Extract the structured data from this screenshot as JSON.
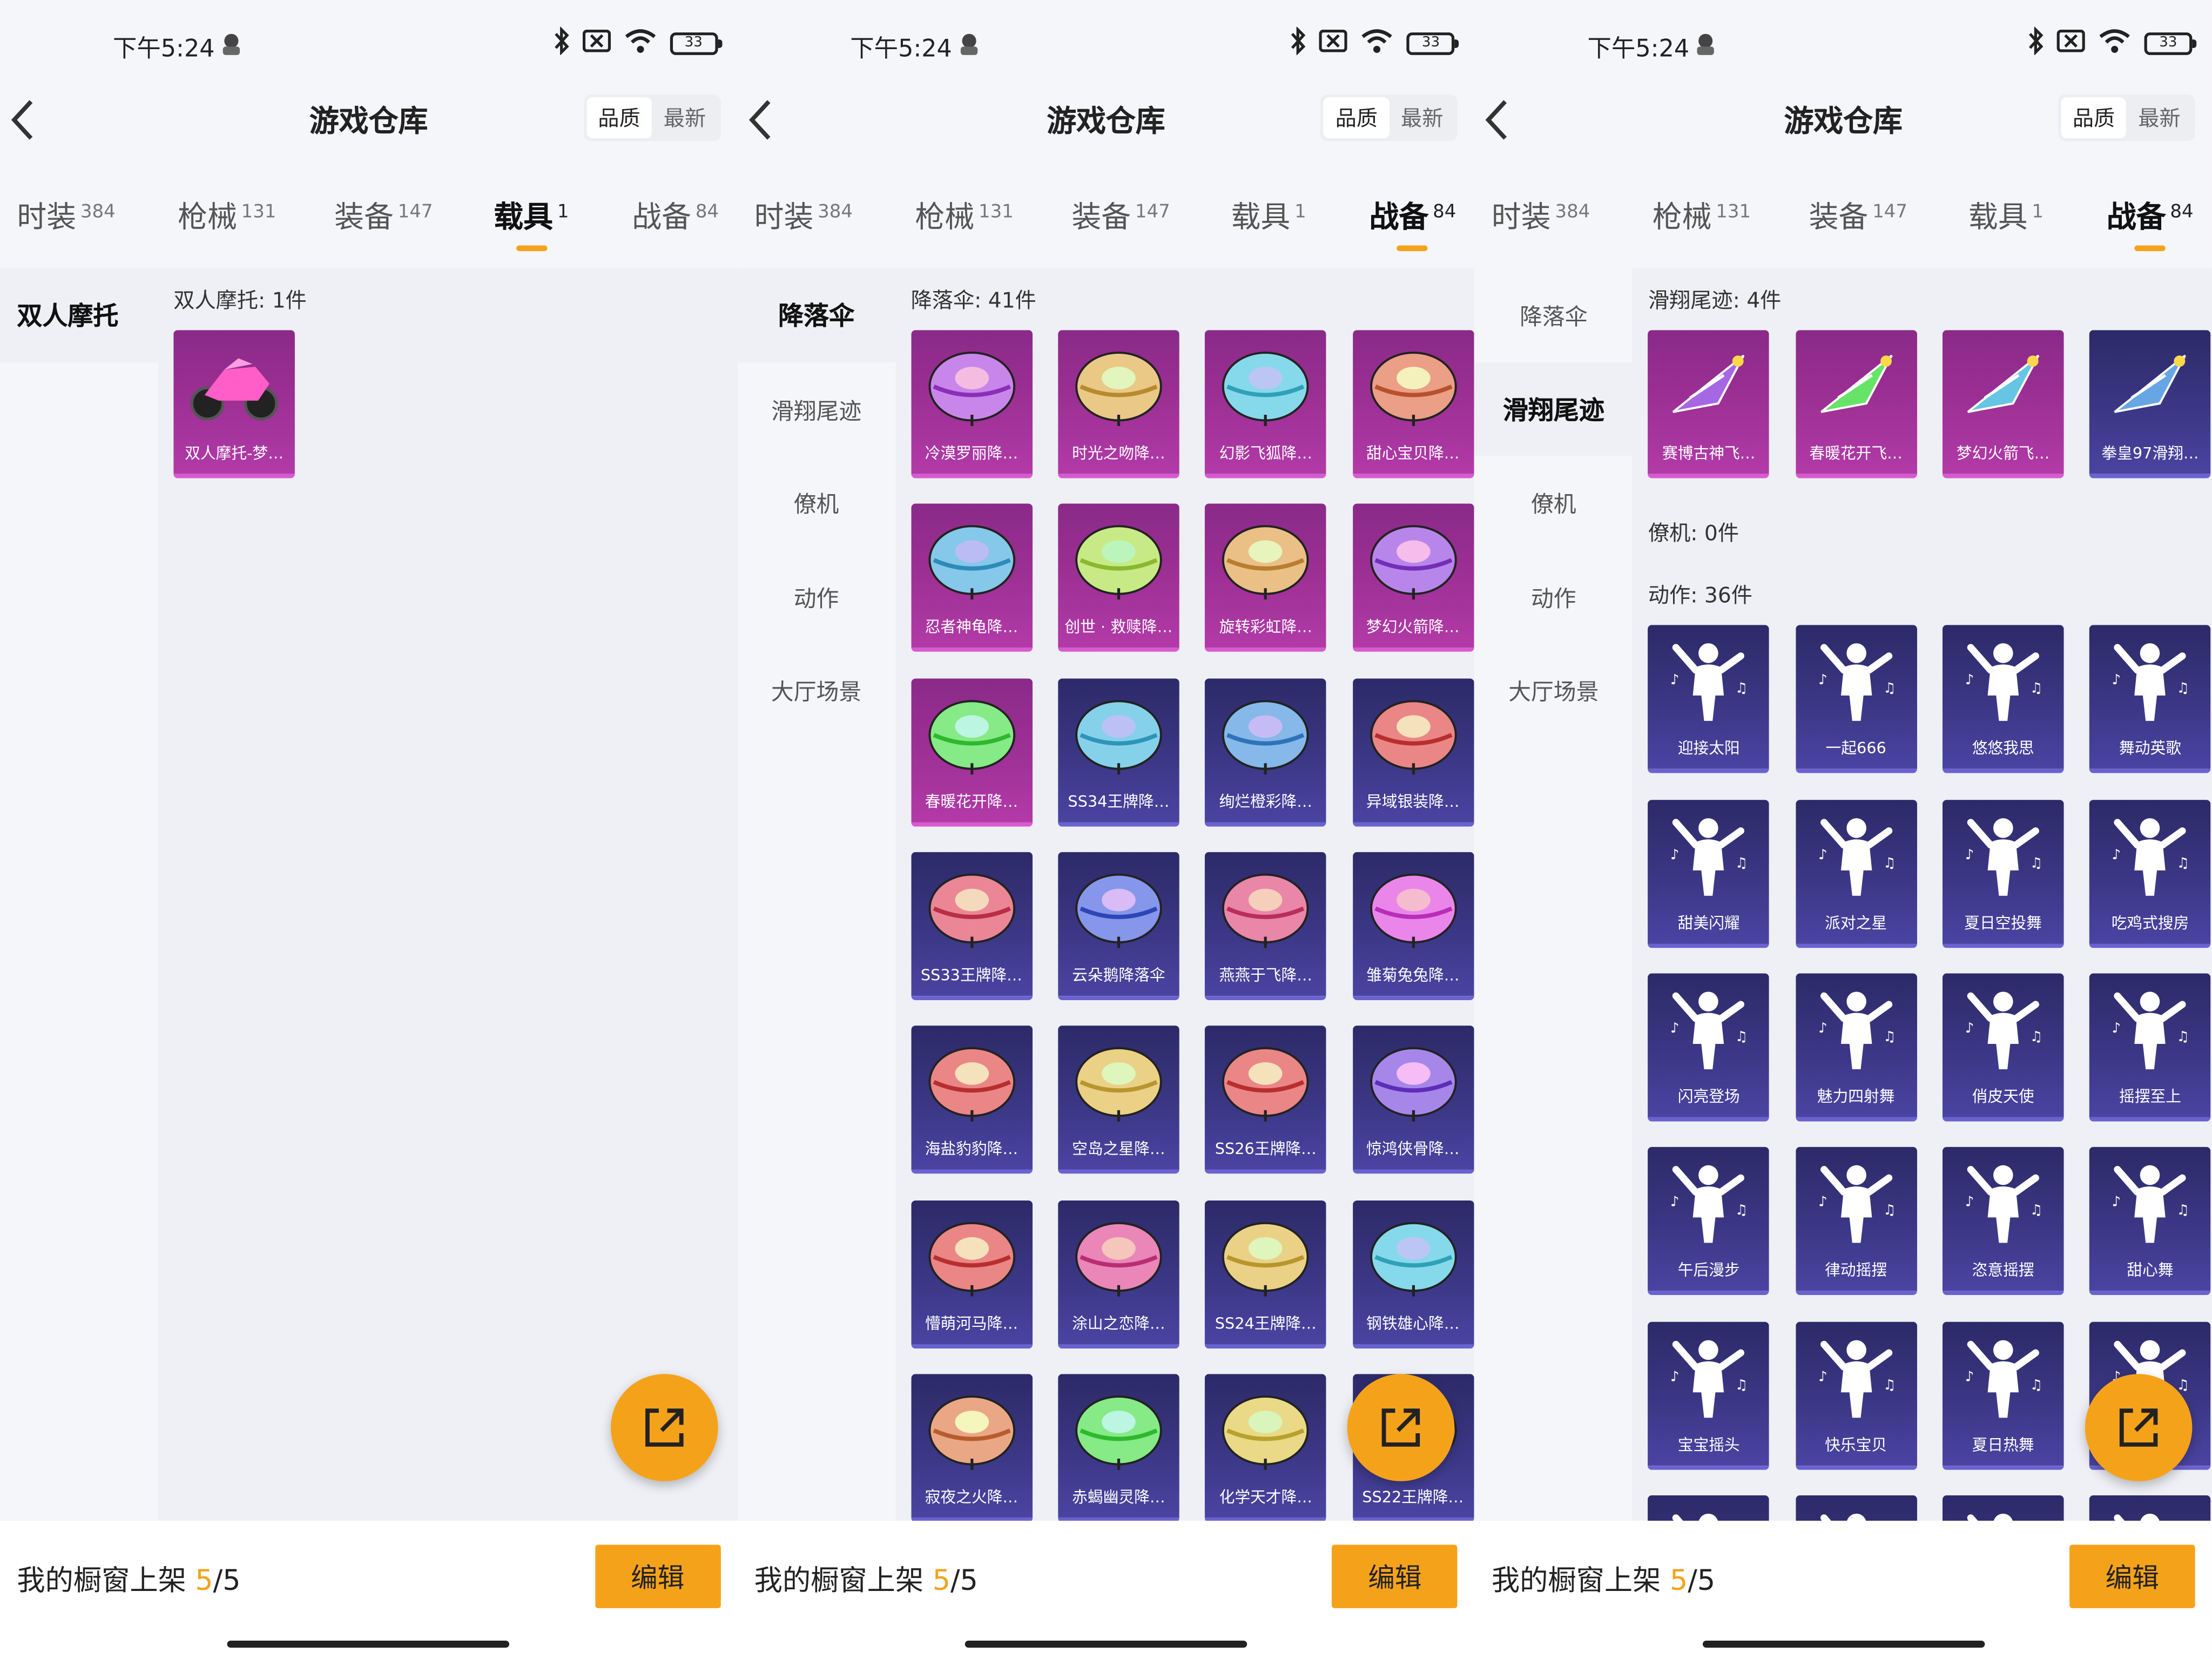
{
  "status": {
    "time": "下午5:24",
    "battery": "33"
  },
  "header": {
    "title": "游戏仓库",
    "sort_quality": "品质",
    "sort_latest": "最新"
  },
  "tabs": [
    {
      "label": "时装",
      "count": "384"
    },
    {
      "label": "枪械",
      "count": "131"
    },
    {
      "label": "装备",
      "count": "147"
    },
    {
      "label": "载具",
      "count": "1"
    },
    {
      "label": "战备",
      "count": "84"
    }
  ],
  "accent_color": "#f5a21b",
  "panels": [
    {
      "active_tab": 3,
      "sidebar": [
        "双人摩托"
      ],
      "active_side": 0,
      "sections": [
        {
          "title": "双人摩托: 1件",
          "items": [
            {
              "name": "双人摩托-梦…",
              "tier": "pink",
              "icon": "motorcycle-icon"
            }
          ]
        }
      ]
    },
    {
      "active_tab": 4,
      "sidebar": [
        "降落伞",
        "滑翔尾迹",
        "僚机",
        "动作",
        "大厅场景"
      ],
      "active_side": 0,
      "sections": [
        {
          "title": "降落伞: 41件",
          "items": [
            {
              "name": "冷漠罗丽降…",
              "tier": "pink",
              "icon": "parachute-icon"
            },
            {
              "name": "时光之吻降…",
              "tier": "pink",
              "icon": "parachute-icon"
            },
            {
              "name": "幻影飞狐降…",
              "tier": "pink",
              "icon": "parachute-icon"
            },
            {
              "name": "甜心宝贝降…",
              "tier": "pink",
              "icon": "parachute-icon"
            },
            {
              "name": "忍者神龟降…",
              "tier": "pink",
              "icon": "parachute-icon"
            },
            {
              "name": "创世 · 救赎降…",
              "tier": "pink",
              "icon": "parachute-icon"
            },
            {
              "name": "旋转彩虹降…",
              "tier": "pink",
              "icon": "parachute-icon"
            },
            {
              "name": "梦幻火箭降…",
              "tier": "pink",
              "icon": "parachute-icon"
            },
            {
              "name": "春暖花开降…",
              "tier": "pink",
              "icon": "parachute-icon"
            },
            {
              "name": "SS34王牌降…",
              "tier": "blue",
              "icon": "parachute-icon"
            },
            {
              "name": "绚烂橙彩降…",
              "tier": "blue",
              "icon": "parachute-icon"
            },
            {
              "name": "异域银装降…",
              "tier": "blue",
              "icon": "parachute-icon"
            },
            {
              "name": "SS33王牌降…",
              "tier": "blue",
              "icon": "parachute-icon"
            },
            {
              "name": "云朵鹅降落伞",
              "tier": "blue",
              "icon": "parachute-icon"
            },
            {
              "name": "燕燕于飞降…",
              "tier": "blue",
              "icon": "parachute-icon"
            },
            {
              "name": "雏菊兔兔降…",
              "tier": "blue",
              "icon": "parachute-icon"
            },
            {
              "name": "海盐豹豹降…",
              "tier": "blue",
              "icon": "parachute-icon"
            },
            {
              "name": "空岛之星降…",
              "tier": "blue",
              "icon": "parachute-icon"
            },
            {
              "name": "SS26王牌降…",
              "tier": "blue",
              "icon": "parachute-icon"
            },
            {
              "name": "惊鸿侠骨降…",
              "tier": "blue",
              "icon": "parachute-icon"
            },
            {
              "name": "懵萌河马降…",
              "tier": "blue",
              "icon": "parachute-icon"
            },
            {
              "name": "涂山之恋降…",
              "tier": "blue",
              "icon": "parachute-icon"
            },
            {
              "name": "SS24王牌降…",
              "tier": "blue",
              "icon": "parachute-icon"
            },
            {
              "name": "钢铁雄心降…",
              "tier": "blue",
              "icon": "parachute-icon"
            },
            {
              "name": "寂夜之火降…",
              "tier": "blue",
              "icon": "parachute-icon"
            },
            {
              "name": "赤蝎幽灵降…",
              "tier": "blue",
              "icon": "parachute-icon"
            },
            {
              "name": "化学天才降…",
              "tier": "blue",
              "icon": "parachute-icon"
            },
            {
              "name": "SS22王牌降…",
              "tier": "blue",
              "icon": "parachute-icon"
            }
          ]
        }
      ]
    },
    {
      "active_tab": 4,
      "sidebar": [
        "降落伞",
        "滑翔尾迹",
        "僚机",
        "动作",
        "大厅场景"
      ],
      "active_side": 1,
      "sections": [
        {
          "title": "滑翔尾迹: 4件",
          "items": [
            {
              "name": "赛博古神飞…",
              "tier": "pink",
              "icon": "glide-trail-icon"
            },
            {
              "name": "春暖花开飞…",
              "tier": "pink",
              "icon": "glide-trail-icon"
            },
            {
              "name": "梦幻火箭飞…",
              "tier": "pink",
              "icon": "glide-trail-icon"
            },
            {
              "name": "拳皇97滑翔…",
              "tier": "blue",
              "icon": "glide-trail-icon"
            }
          ]
        },
        {
          "title": "僚机: 0件",
          "items": []
        },
        {
          "title": "动作: 36件",
          "items": [
            {
              "name": "迎接太阳",
              "tier": "blue",
              "icon": "dance-pose-icon"
            },
            {
              "name": "一起666",
              "tier": "blue",
              "icon": "dance-pose-icon"
            },
            {
              "name": "悠悠我思",
              "tier": "blue",
              "icon": "dance-pose-icon"
            },
            {
              "name": "舞动英歌",
              "tier": "blue",
              "icon": "dance-pose-icon"
            },
            {
              "name": "甜美闪耀",
              "tier": "blue",
              "icon": "dance-pose-icon"
            },
            {
              "name": "派对之星",
              "tier": "blue",
              "icon": "dance-pose-icon"
            },
            {
              "name": "夏日空投舞",
              "tier": "blue",
              "icon": "dance-pose-icon"
            },
            {
              "name": "吃鸡式搜房",
              "tier": "blue",
              "icon": "dance-pose-icon"
            },
            {
              "name": "闪亮登场",
              "tier": "blue",
              "icon": "dance-pose-icon"
            },
            {
              "name": "魅力四射舞",
              "tier": "blue",
              "icon": "dance-pose-icon"
            },
            {
              "name": "俏皮天使",
              "tier": "blue",
              "icon": "dance-pose-icon"
            },
            {
              "name": "摇摆至上",
              "tier": "blue",
              "icon": "dance-pose-icon"
            },
            {
              "name": "午后漫步",
              "tier": "blue",
              "icon": "dance-pose-icon"
            },
            {
              "name": "律动摇摆",
              "tier": "blue",
              "icon": "dance-pose-icon"
            },
            {
              "name": "恣意摇摆",
              "tier": "blue",
              "icon": "dance-pose-icon"
            },
            {
              "name": "甜心舞",
              "tier": "blue",
              "icon": "dance-pose-icon"
            },
            {
              "name": "宝宝摇头",
              "tier": "blue",
              "icon": "dance-pose-icon"
            },
            {
              "name": "快乐宝贝",
              "tier": "blue",
              "icon": "dance-pose-icon"
            },
            {
              "name": "夏日热舞",
              "tier": "blue",
              "icon": "dance-pose-icon"
            },
            {
              "name": "",
              "tier": "blue",
              "icon": "dance-pose-icon"
            },
            {
              "name": "",
              "tier": "blue",
              "icon": "dance-pose-icon"
            },
            {
              "name": "",
              "tier": "blue",
              "icon": "dance-pose-icon"
            },
            {
              "name": "",
              "tier": "blue",
              "icon": "dance-pose-icon"
            },
            {
              "name": "",
              "tier": "blue",
              "icon": "dance-pose-icon"
            }
          ]
        }
      ]
    }
  ],
  "bottom": {
    "showcase_label": "我的橱窗上架",
    "showcase_current": "5",
    "showcase_total": "/5",
    "edit_label": "编辑"
  }
}
